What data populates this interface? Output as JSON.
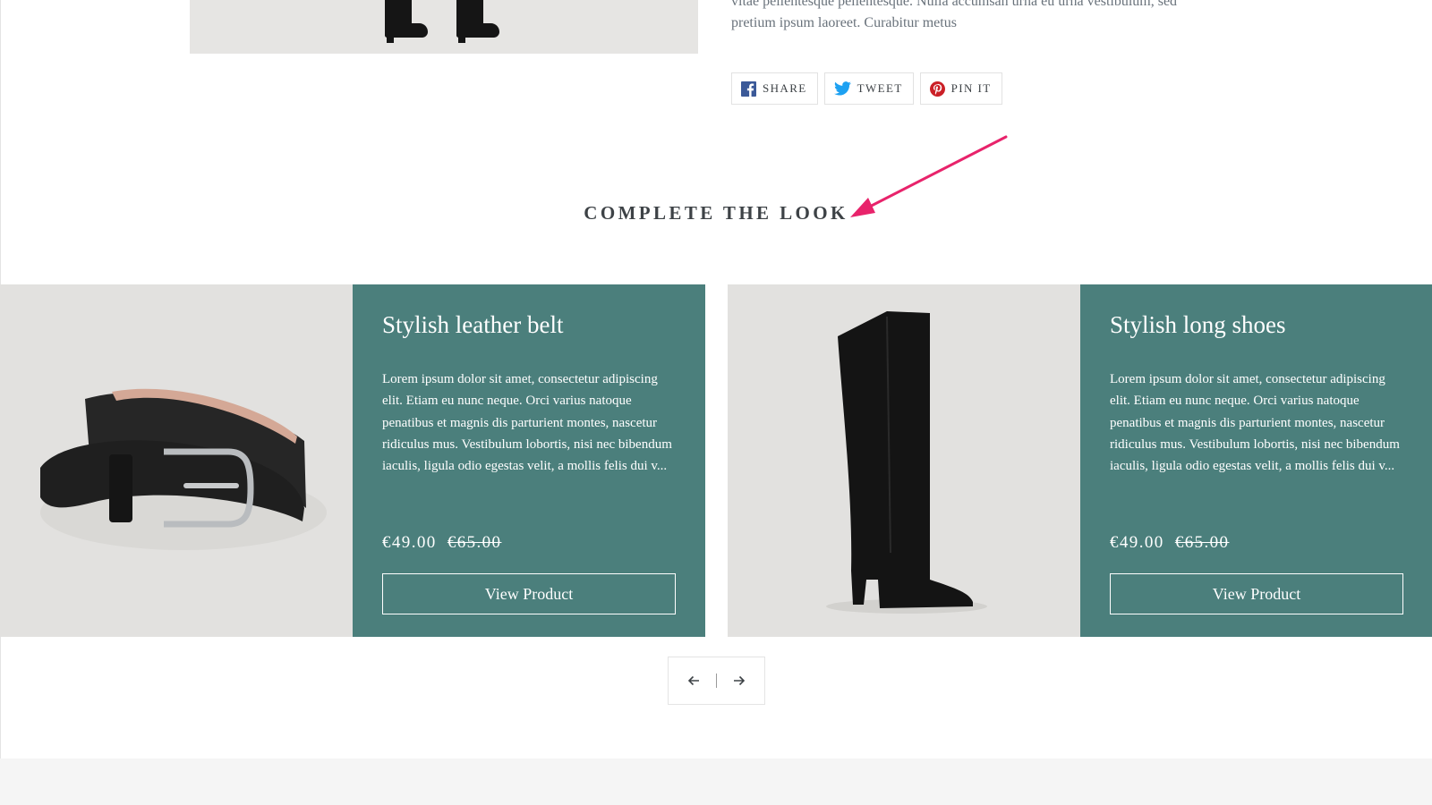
{
  "product_description": {
    "text_line_1": "vitae pellentesque pellentesque. Nulla accumsan urna eu urna vestibulum, sed",
    "text_line_2": "pretium ipsum laoreet. Curabitur metus"
  },
  "share": {
    "facebook": {
      "label": "SHARE",
      "icon": "facebook-icon",
      "color": "#3b5998"
    },
    "twitter": {
      "label": "TWEET",
      "icon": "twitter-icon",
      "color": "#1da1f2"
    },
    "pinterest": {
      "label": "PIN IT",
      "icon": "pinterest-icon",
      "color": "#cb2027"
    }
  },
  "annotation": {
    "icon": "arrow-icon",
    "color": "#e8236b"
  },
  "section": {
    "title": "COMPLETE THE LOOK"
  },
  "products": [
    {
      "title": "Stylish leather belt",
      "description": "Lorem ipsum dolor sit amet, consectetur adipiscing elit. Etiam eu nunc neque. Orci varius natoque penatibus et magnis dis parturient montes, nascetur ridiculus mus. Vestibulum lobortis, nisi nec bibendum iaculis, ligula odio egestas velit, a mollis felis dui v...",
      "price": "€49.00",
      "compare_price": "€65.00",
      "button": "View Product",
      "image_icon": "belt-image"
    },
    {
      "title": "Stylish long shoes",
      "description": "Lorem ipsum dolor sit amet, consectetur adipiscing elit. Etiam eu nunc neque. Orci varius natoque penatibus et magnis dis parturient montes, nascetur ridiculus mus. Vestibulum lobortis, nisi nec bibendum iaculis, ligula odio egestas velit, a mollis felis dui v...",
      "price": "€49.00",
      "compare_price": "€65.00",
      "button": "View Product",
      "image_icon": "boot-image"
    }
  ],
  "carousel": {
    "prev_icon": "arrow-left-icon",
    "next_icon": "arrow-right-icon"
  },
  "colors": {
    "accent_teal": "#4b7f7c",
    "text": "#3d4246",
    "annotation_pink": "#e8236b"
  }
}
